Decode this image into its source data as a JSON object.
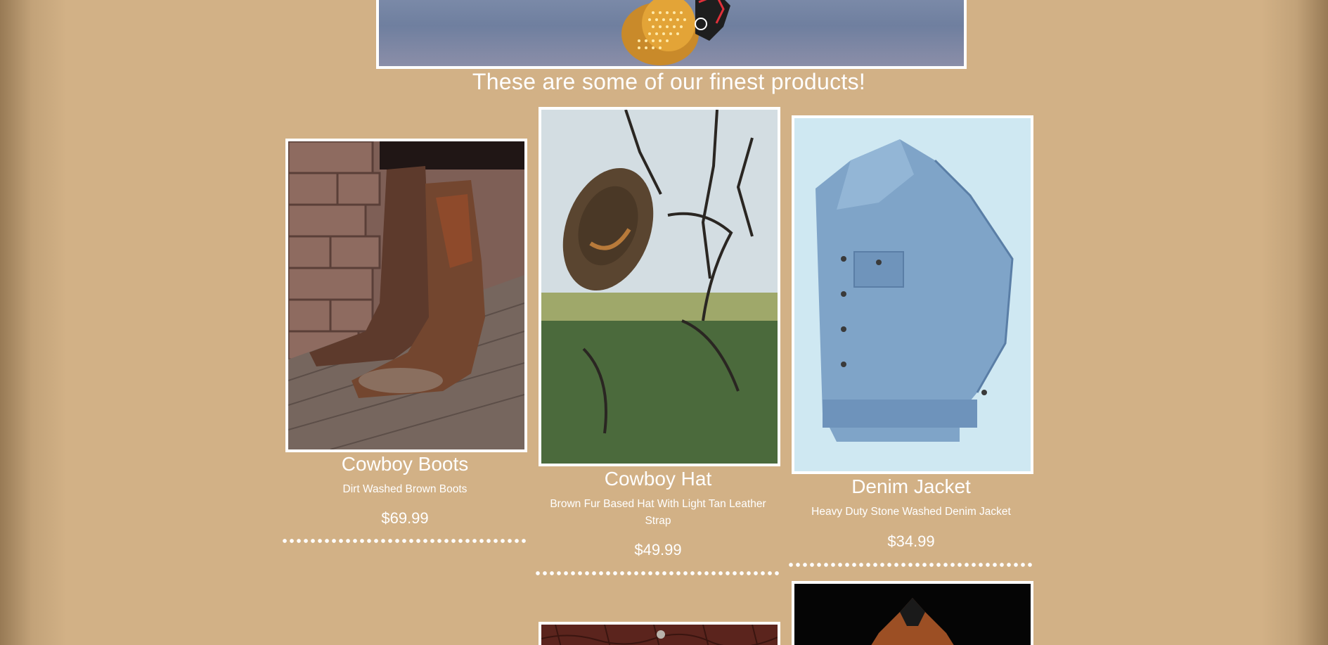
{
  "page": {
    "tagline": "These are some of our finest products!",
    "colors": {
      "background": "#d2b186",
      "text": "#ffffff",
      "frame": "#ffffff"
    }
  },
  "hero": {
    "image": "neon-cowboy-sign-banner"
  },
  "products": [
    {
      "name": "Cowboy Boots",
      "description": "Dirt Washed Brown Boots",
      "price": "$69.99",
      "image": "cowboy-boots-photo"
    },
    {
      "name": "Cowboy Hat",
      "description": "Brown Fur Based Hat With Light Tan Leather Strap",
      "price": "$49.99",
      "image": "cowboy-hat-photo"
    },
    {
      "name": "Denim Jacket",
      "description": "Heavy Duty Stone Washed Denim Jacket",
      "price": "$34.99",
      "image": "denim-jacket-photo"
    }
  ],
  "more_products": [
    {
      "image": "leather-product-photo"
    },
    {
      "image": "leather-vest-photo"
    }
  ]
}
